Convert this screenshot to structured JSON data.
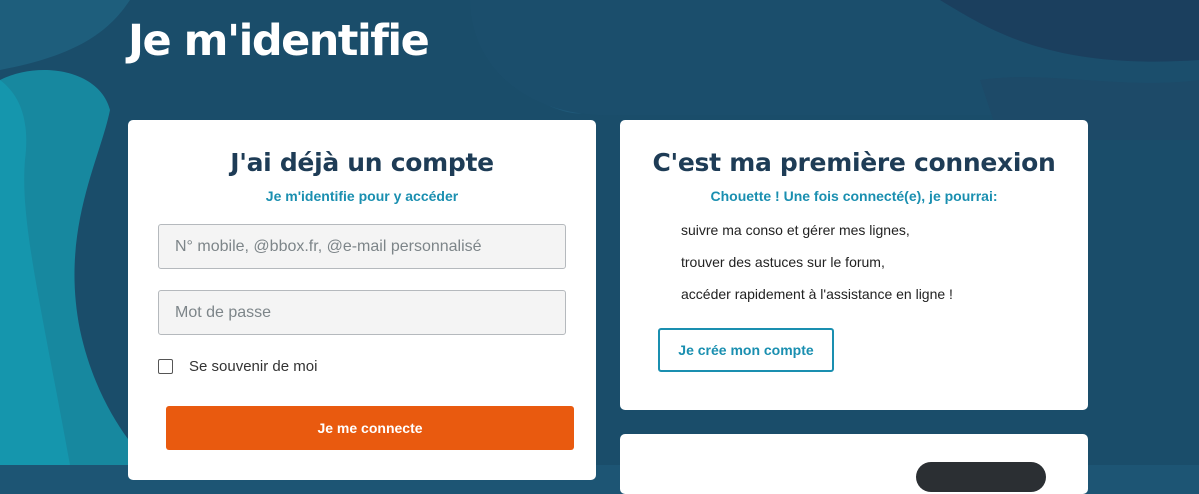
{
  "page": {
    "title": "Je m'identifie"
  },
  "login": {
    "title": "J'ai déjà un compte",
    "subtitle": "Je m'identifie pour y accéder",
    "login_placeholder": "N° mobile, @bbox.fr, @e-mail personnalisé",
    "password_placeholder": "Mot de passe",
    "remember_label": "Se souvenir de moi",
    "remember_checked": false,
    "submit_label": "Je me connecte"
  },
  "first_connection": {
    "title": "C'est ma première connexion",
    "subtitle": "Chouette ! Une fois connecté(e), je pourrai:",
    "benefits": [
      "suivre ma conso et gérer mes lignes,",
      "trouver des astuces sur le forum,",
      "accéder rapidement à l'assistance en ligne !"
    ],
    "create_label": "Je crée mon compte"
  },
  "colors": {
    "background": "#1d5574",
    "title_text": "#1e3c56",
    "accent_blue": "#1a8fb0",
    "accent_orange": "#e95a0f"
  }
}
